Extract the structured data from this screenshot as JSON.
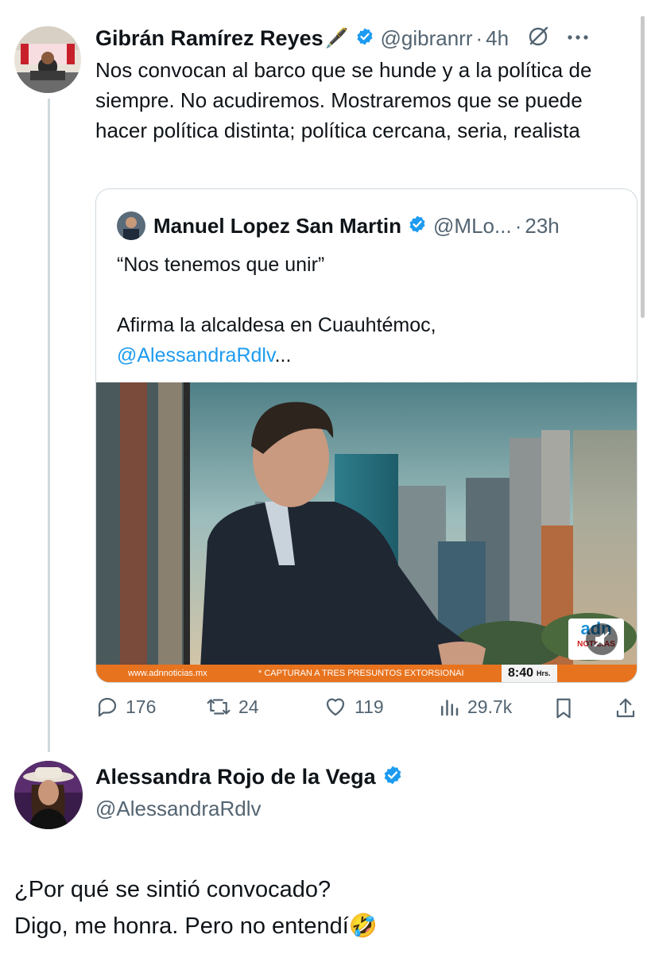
{
  "main_tweet": {
    "author_name": "Gibrán Ramírez Reyes",
    "author_emoji": "🖋️",
    "handle": "@gibranrr",
    "separator": "·",
    "time": "4h",
    "text": "Nos convocan al barco que se hunde y a la política de siempre. No acudiremos. Mostraremos que se puede hacer política distinta; política cercana, seria, realista"
  },
  "quoted_tweet": {
    "author_name": "Manuel Lopez San Martin",
    "handle": "@MLo...",
    "separator": "·",
    "time": "23h",
    "line1": "“Nos tenemos que unir”",
    "line2": "Afirma la alcaldesa en Cuauhtémoc,",
    "mention": "@AlessandraRdlv",
    "ellipsis": "...",
    "media": {
      "website": "www.adnnoticias.mx",
      "ticker": "* CAPTURAN A TRES PRESUNTOS EXTORSIONAI",
      "clock": "8:40",
      "clock_unit": "Hrs.",
      "logo_top": "adn",
      "logo_bottom": "NOTICIAS"
    }
  },
  "actions": {
    "replies": "176",
    "retweets": "24",
    "likes": "119",
    "views": "29.7k"
  },
  "reply": {
    "author_name": "Alessandra Rojo de la Vega",
    "handle": "@AlessandraRdlv",
    "line1": "¿Por qué se sintió convocado?",
    "line2": "Digo, me honra. Pero no entendí",
    "emoji": "🤣"
  },
  "colors": {
    "verified": "#1d9bf0",
    "link": "#1d9bf0",
    "muted": "#536471",
    "ticker": "#e8731e"
  }
}
